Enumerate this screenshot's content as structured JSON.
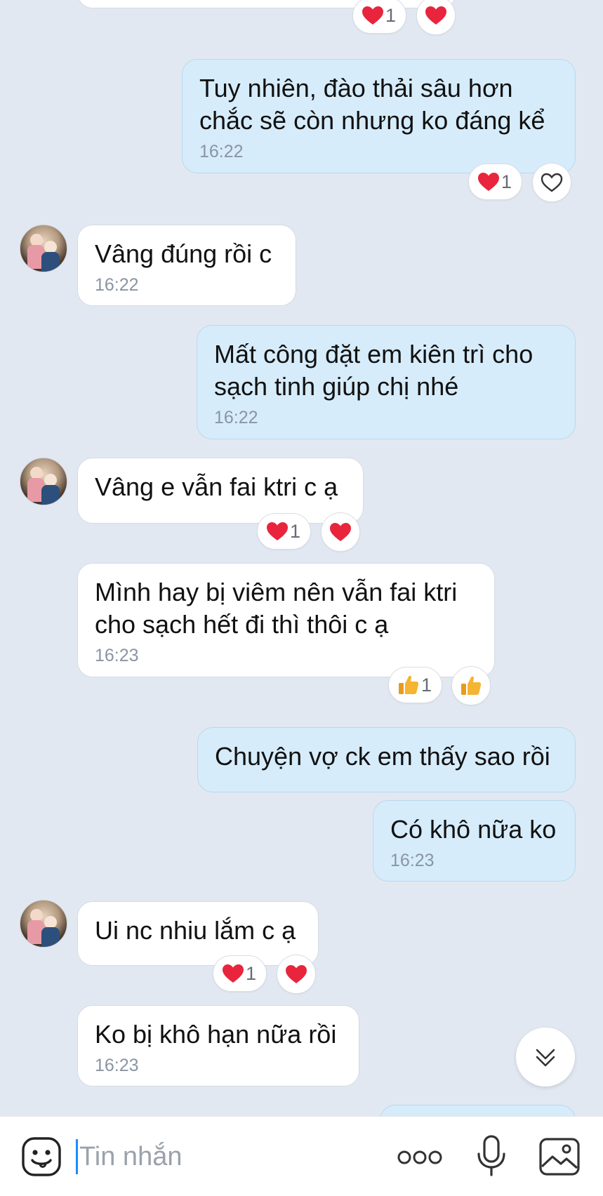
{
  "messages": [
    {
      "id": "m0",
      "side": "out",
      "text": [
        "Tuy nhiên, đào thải sâu hơn",
        "chắc sẽ còn nhưng ko đáng kể"
      ],
      "time": "16:22"
    },
    {
      "id": "m1",
      "side": "in",
      "text": [
        "Vâng đúng rồi c"
      ],
      "time": "16:22"
    },
    {
      "id": "m2",
      "side": "out",
      "text": [
        "Mất công đặt em kiên trì cho",
        "sạch tinh giúp chị nhé"
      ],
      "time": "16:22"
    },
    {
      "id": "m3",
      "side": "in",
      "text": [
        "Vâng e vẫn fai ktri c ạ"
      ],
      "time": ""
    },
    {
      "id": "m4",
      "side": "in",
      "text": [
        "Mình hay bị viêm nên vẫn fai ktri",
        "cho sạch hết đi thì thôi c ạ"
      ],
      "time": "16:23"
    },
    {
      "id": "m5",
      "side": "out",
      "text": [
        "Chuyện vợ ck em thấy sao rồi"
      ],
      "time": ""
    },
    {
      "id": "m6",
      "side": "out",
      "text": [
        "Có khô nữa ko"
      ],
      "time": "16:23"
    },
    {
      "id": "m7",
      "side": "in",
      "text": [
        "Ui nc nhiu lắm c ạ"
      ],
      "time": ""
    },
    {
      "id": "m8",
      "side": "in",
      "text": [
        "Ko bị khô hạn nữa rồi"
      ],
      "time": "16:23"
    }
  ],
  "reactions": [
    {
      "for": "top",
      "emoji": "heart",
      "count": "1"
    },
    {
      "for": "m0",
      "emoji": "heart",
      "count": "1"
    },
    {
      "for": "m3",
      "emoji": "heart",
      "count": "1"
    },
    {
      "for": "m4",
      "emoji": "thumbs-up",
      "count": "1"
    },
    {
      "for": "m7",
      "emoji": "heart",
      "count": "1"
    }
  ],
  "composer": {
    "placeholder": "Tin nhắn"
  },
  "colors": {
    "background": "#e2e8f1",
    "incoming_bubble": "#ffffff",
    "outgoing_bubble": "#d6ecfb",
    "heart": "#e8253c",
    "thumb": "#f5b431",
    "caret": "#1a8cff"
  }
}
